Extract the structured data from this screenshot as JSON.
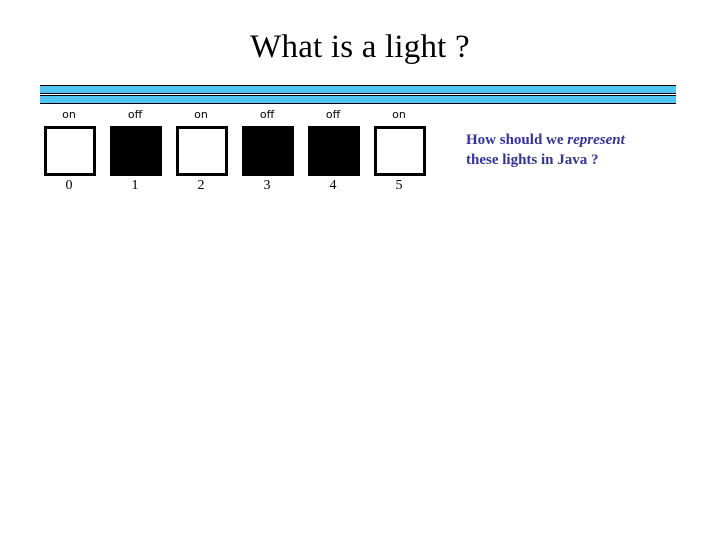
{
  "slide": {
    "title": "What is a light ?",
    "background_color": "#ffffff"
  },
  "divider": {
    "bar_color": "#4FC6F2",
    "border_color": "#000000",
    "bar_count": 2
  },
  "lights": {
    "on_label": "on",
    "off_label": "off",
    "items": [
      {
        "index": "0",
        "state_label": "on",
        "state": "on"
      },
      {
        "index": "1",
        "state_label": "off",
        "state": "off"
      },
      {
        "index": "2",
        "state_label": "on",
        "state": "on"
      },
      {
        "index": "3",
        "state_label": "off",
        "state": "off"
      },
      {
        "index": "4",
        "state_label": "off",
        "state": "off"
      },
      {
        "index": "5",
        "state_label": "on",
        "state": "on"
      }
    ]
  },
  "question": {
    "color": "#333399",
    "line1_before": "How should we ",
    "line1_emphasis": "represent",
    "line2": "these lights in Java ?",
    "full_text": "How should we represent these lights in Java ?"
  }
}
